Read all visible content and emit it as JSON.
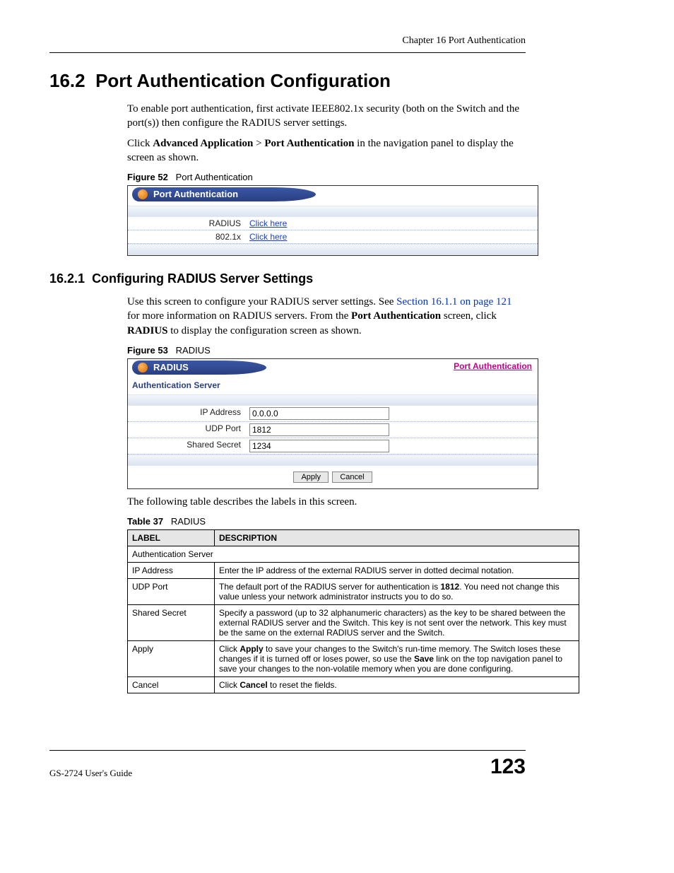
{
  "header": {
    "chapter": "Chapter 16 Port Authentication"
  },
  "sec162": {
    "number": "16.2",
    "title": "Port Authentication Configuration",
    "p1": "To enable port authentication, first activate IEEE802.1x security (both on the Switch and the port(s)) then configure the RADIUS server settings.",
    "p2a": "Click ",
    "p2b": "Advanced Application",
    "p2c": " > ",
    "p2d": "Port Authentication",
    "p2e": " in the navigation panel to display the screen as shown."
  },
  "fig52": {
    "label": "Figure 52",
    "title": "Port Authentication",
    "tab": "Port Authentication",
    "rows": [
      {
        "label": "RADIUS",
        "link": "Click here"
      },
      {
        "label": "802.1x",
        "link": "Click here"
      }
    ]
  },
  "sec1621": {
    "number": "16.2.1",
    "title": "Configuring RADIUS Server Settings",
    "p1a": "Use this screen to configure your RADIUS server settings. See ",
    "p1link": "Section 16.1.1 on page 121",
    "p1b": " for more information on RADIUS servers. From the ",
    "p1c": "Port Authentication",
    "p1d": " screen, click ",
    "p1e": "RADIUS",
    "p1f": " to display the configuration screen as shown."
  },
  "fig53": {
    "label": "Figure 53",
    "title": "RADIUS",
    "tab": "RADIUS",
    "right_link": "Port Authentication",
    "subheader": "Authentication Server",
    "rows": [
      {
        "label": "IP Address",
        "value": "0.0.0.0"
      },
      {
        "label": "UDP Port",
        "value": "1812"
      },
      {
        "label": "Shared Secret",
        "value": "1234"
      }
    ],
    "apply": "Apply",
    "cancel": "Cancel"
  },
  "table_intro": "The following table describes the labels in this screen.",
  "tbl37": {
    "label": "Table 37",
    "title": "RADIUS",
    "h1": "LABEL",
    "h2": "DESCRIPTION",
    "rows": {
      "span": "Authentication Server",
      "r1l": "IP Address",
      "r1d": "Enter the IP address of the external RADIUS server in dotted decimal notation.",
      "r2l": "UDP Port",
      "r2da": "The default port of the RADIUS server for authentication is ",
      "r2db": "1812",
      "r2dc": ". You need not change this value unless your network administrator instructs you to do so.",
      "r3l": "Shared Secret",
      "r3d": "Specify a password (up to 32 alphanumeric characters) as the key to be shared between the external RADIUS server and the Switch. This key is not sent over the network. This key must be the same on the external RADIUS server and the Switch.",
      "r4l": "Apply",
      "r4da": "Click ",
      "r4db": "Apply",
      "r4dc": " to save your changes to the Switch's run-time memory. The Switch loses these changes if it is turned off or loses power, so use the ",
      "r4dd": "Save",
      "r4de": " link on the top navigation panel to save your changes to the non-volatile memory when you are done configuring.",
      "r5l": "Cancel",
      "r5da": "Click ",
      "r5db": "Cancel",
      "r5dc": " to reset the fields."
    }
  },
  "footer": {
    "guide": "GS-2724 User's Guide",
    "page": "123"
  }
}
